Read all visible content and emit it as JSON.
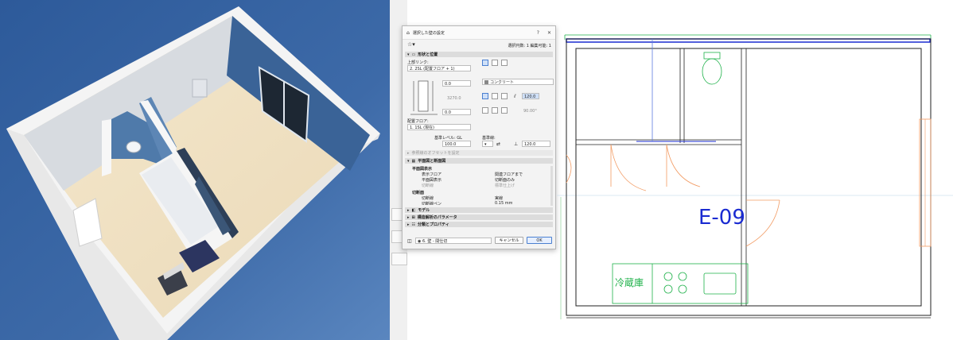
{
  "dialog": {
    "title": "選択した壁の設定",
    "help": "?",
    "close": "✕",
    "selection_info": "選択円数: 1 編集可能: 1",
    "sections": {
      "shape": "形状と位置",
      "offset": "参照線のオフセットを設定",
      "plan_section": "平面図と断面図",
      "model": "モデル",
      "structural": "構造解析のパラメータ",
      "classification": "分類とプロパティ"
    },
    "top_link_label": "上部リンク:",
    "top_link_value": "2. 2SL (配置フロア + 1)",
    "offset_top": "0.0",
    "height_value": "3270.0",
    "offset_bottom": "0.0",
    "home_floor_label": "配置フロア:",
    "home_floor_value": "1. 1SL (現在)",
    "ref_level_label": "基準レベル: GL",
    "ref_level_value": "100.0",
    "material": "コンクリート",
    "thickness": "120.0",
    "angle": "90.00°",
    "ref_line_label": "基準線:",
    "ref_line_value": "120.0",
    "plan_display": {
      "heading": "平面図表示",
      "rows": [
        {
          "label": "表示フロア",
          "value": "関連フロアまで"
        },
        {
          "label": "平面図表示",
          "value": "切断面のみ"
        },
        {
          "label": "切断線",
          "value": "標準仕上げ"
        }
      ],
      "cut_heading": "切断面",
      "cut_rows": [
        {
          "label": "切断線",
          "value": "実線"
        },
        {
          "label": "切断線ペン",
          "value": "0.15 mm"
        }
      ]
    },
    "footer_layer": "6. 壁 - 間仕切",
    "cancel": "キャンセル",
    "ok": "OK"
  },
  "plan": {
    "room_label": "E-09",
    "fridge_label": "冷蔵庫"
  },
  "colors": {
    "sky_blue": "#3d66a6",
    "floor": "#f0e4cb",
    "wall_blue": "#355f96",
    "plan_green": "#1fb14a",
    "plan_blue": "#1a2bd1",
    "door_orange": "#f29b63"
  }
}
